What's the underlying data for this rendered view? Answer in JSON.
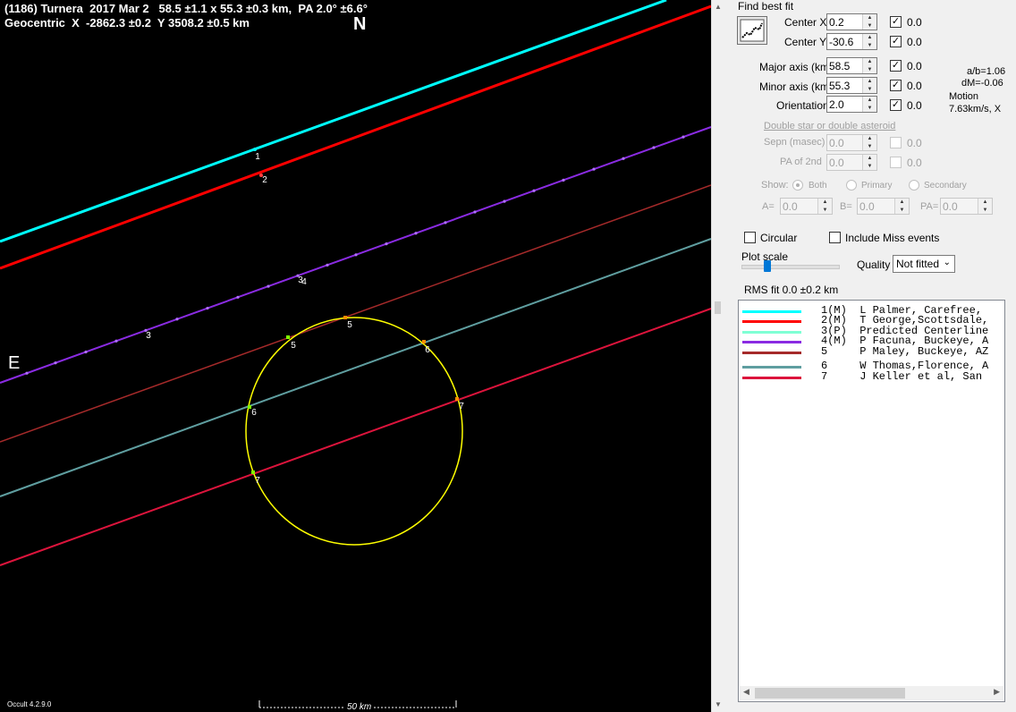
{
  "plot": {
    "header_line1": "(1186) Turnera  2017 Mar 2   58.5 ±1.1 x 55.3 ±0.3 km,  PA 2.0° ±6.6°",
    "header_line2": "Geocentric  X  -2862.3 ±0.2  Y 3508.2 ±0.5 km",
    "north_label": "N",
    "east_label": "E",
    "version": "Occult 4.2.9.0",
    "scale_label": "50 km",
    "ellipse_color": "#ffff00",
    "chord_labels": [
      "1",
      "2",
      "3",
      "3",
      "4",
      "5",
      "5",
      "6",
      "6",
      "7",
      "7"
    ]
  },
  "panel": {
    "find_best_fit": "Find best fit",
    "fit_button_icon": "fit-graph-icon",
    "center_x": {
      "label": "Center X",
      "value": "0.2",
      "check_label": "0.0"
    },
    "center_y": {
      "label": "Center Y",
      "value": "-30.6",
      "check_label": "0.0"
    },
    "major_axis": {
      "label": "Major axis (km)",
      "value": "58.5",
      "check_label": "0.0"
    },
    "minor_axis": {
      "label": "Minor axis (km)",
      "value": "55.3",
      "check_label": "0.0"
    },
    "orientation": {
      "label": "Orientation",
      "value": "2.0",
      "check_label": "0.0"
    },
    "ratio_ab": "a/b=1.06",
    "dm": "dM=-0.06",
    "motion_title": "Motion",
    "motion_value": "7.63km/s, X",
    "double_star": "Double star  or  double asteroid",
    "sepn": {
      "label": "Sepn (masec)",
      "value": "0.0",
      "check_label": "0.0"
    },
    "pa_2nd": {
      "label": "PA of 2nd",
      "value": "0.0",
      "check_label": "0.0"
    },
    "show_label": "Show:",
    "show_both": "Both",
    "show_primary": "Primary",
    "show_secondary": "Secondary",
    "a_label": "A=",
    "a_value": "0.0",
    "b_label": "B=",
    "b_value": "0.0",
    "pa_label": "PA=",
    "pa_value": "0.0",
    "circular": "Circular",
    "include_miss": "Include Miss events",
    "plot_scale": "Plot scale",
    "quality_label": "Quality",
    "quality_value": "Not fitted",
    "rms_fit": "RMS fit 0.0 ±0.2 km"
  },
  "legend": [
    {
      "text": "1(M)  L Palmer, Carefree,",
      "color": "#00ffff"
    },
    {
      "text": "2(M)  T George,Scottsdale,",
      "color": "#ff0000"
    },
    {
      "text": "3(P)  Predicted Centerline",
      "color": "#7fffd4"
    },
    {
      "text": "4(M)  P Facuna, Buckeye, A",
      "color": "#8a2be2"
    },
    {
      "text": "5     P Maley, Buckeye, AZ",
      "color": "#a52a2a"
    },
    {
      "text": "6     W Thomas,Florence, A",
      "color": "#5f9ea0"
    },
    {
      "text": "7     J Keller et al, San",
      "color": "#dc143c"
    }
  ]
}
